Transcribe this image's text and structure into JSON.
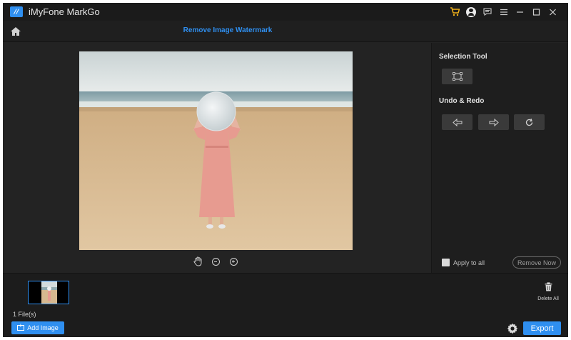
{
  "app": {
    "title": "iMyFone MarkGo",
    "logo_text": "//",
    "title_icons": [
      "cart-icon",
      "account-icon",
      "feedback-icon",
      "menu-icon",
      "minimize-icon",
      "maximize-icon",
      "close-icon"
    ]
  },
  "header": {
    "page_title": "Remove Image Watermark",
    "home_icon": "home-icon"
  },
  "canvas": {
    "tools": [
      "hand-icon",
      "zoom-out-icon",
      "zoom-in-icon"
    ]
  },
  "right_panel": {
    "selection_title": "Selection Tool",
    "undo_redo_title": "Undo & Redo",
    "apply_label": "Apply to all",
    "apply_checked": false,
    "remove_label": "Remove Now"
  },
  "strip": {
    "file_count": "1 File(s)",
    "delete_label": "Delete All"
  },
  "footer": {
    "add_label": "Add Image",
    "export_label": "Export"
  },
  "colors": {
    "accent": "#2f8ff0",
    "background": "#232323",
    "cart": "#f3b21a"
  }
}
